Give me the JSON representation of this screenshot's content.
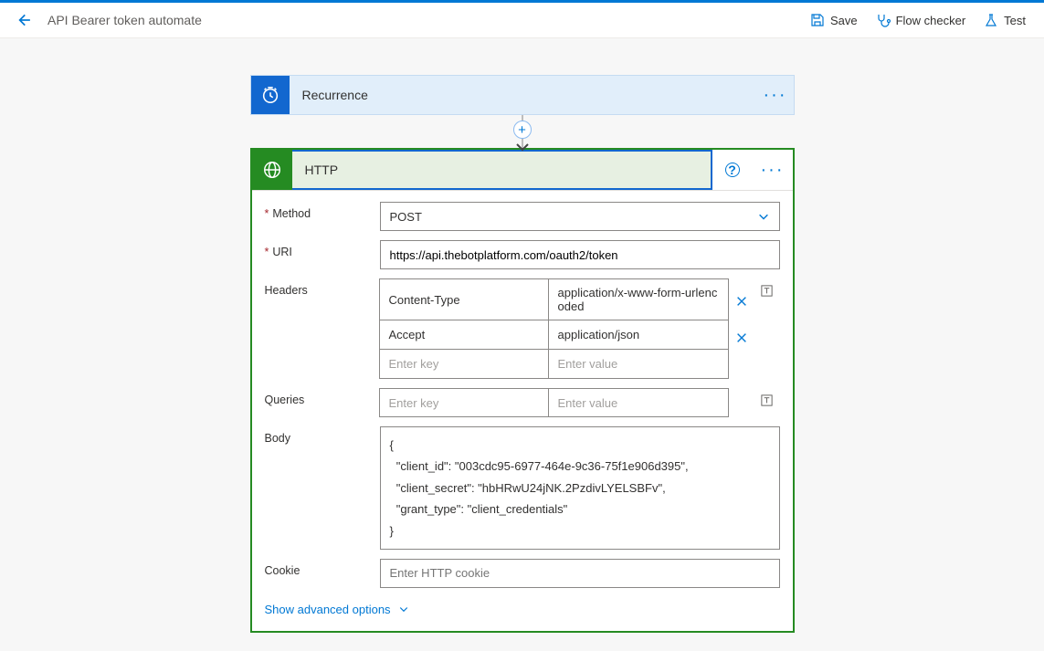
{
  "header": {
    "title": "API Bearer token automate",
    "actions": {
      "save": "Save",
      "checker": "Flow checker",
      "test": "Test"
    }
  },
  "recurrence": {
    "title": "Recurrence"
  },
  "http": {
    "title": "HTTP",
    "fields": {
      "method_label": "Method",
      "method_value": "POST",
      "uri_label": "URI",
      "uri_value": "https://api.thebotplatform.com/oauth2/token",
      "headers_label": "Headers",
      "headers": [
        {
          "key": "Content-Type",
          "value": "application/x-www-form-urlencoded"
        },
        {
          "key": "Accept",
          "value": "application/json"
        }
      ],
      "header_key_ph": "Enter key",
      "header_val_ph": "Enter value",
      "queries_label": "Queries",
      "queries_key_ph": "Enter key",
      "queries_val_ph": "Enter value",
      "body_label": "Body",
      "body_value": "{\n  \"client_id\": \"003cdc95-6977-464e-9c36-75f1e906d395\",\n  \"client_secret\": \"hbHRwU24jNK.2PzdivLYELSBFv\",\n  \"grant_type\": \"client_credentials\"\n}",
      "cookie_label": "Cookie",
      "cookie_ph": "Enter HTTP cookie",
      "advanced": "Show advanced options"
    }
  }
}
